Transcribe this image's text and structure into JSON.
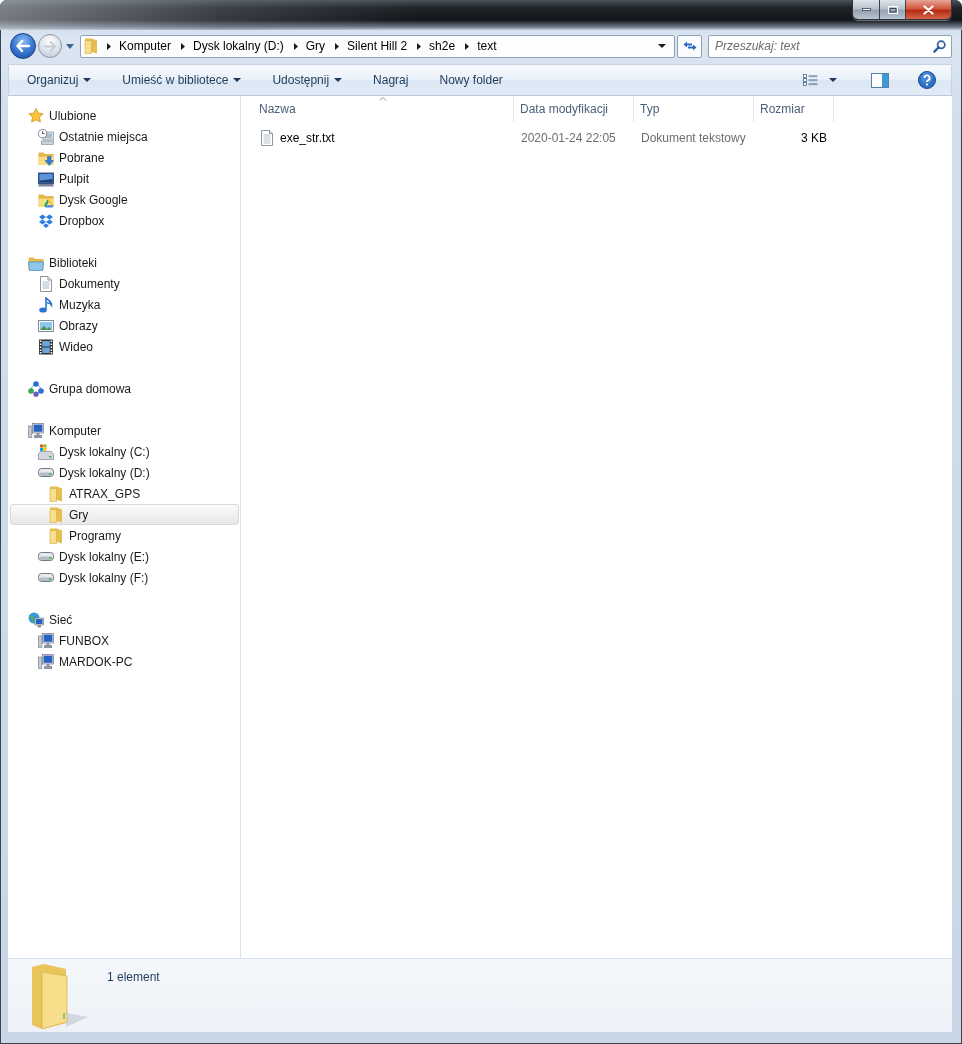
{
  "address_bar": {
    "crumbs": [
      "Komputer",
      "Dysk lokalny (D:)",
      "Gry",
      "Silent Hill 2",
      "sh2e",
      "text"
    ]
  },
  "search": {
    "placeholder": "Przeszukaj: text"
  },
  "toolbar": {
    "items": [
      {
        "label": "Organizuj",
        "has_menu": true
      },
      {
        "label": "Umieść w bibliotece",
        "has_menu": true
      },
      {
        "label": "Udostępnij",
        "has_menu": true
      },
      {
        "label": "Nagraj",
        "has_menu": false
      },
      {
        "label": "Nowy folder",
        "has_menu": false
      }
    ]
  },
  "sidebar": {
    "groups": [
      {
        "label": "Ulubione",
        "kind": "favorites",
        "selected": false,
        "children": [
          {
            "label": "Ostatnie miejsca",
            "kind": "recent",
            "selected": false
          },
          {
            "label": "Pobrane",
            "kind": "downloads",
            "selected": false
          },
          {
            "label": "Pulpit",
            "kind": "desktop",
            "selected": false
          },
          {
            "label": "Dysk Google",
            "kind": "gdrive",
            "selected": false
          },
          {
            "label": "Dropbox",
            "kind": "dropbox",
            "selected": false
          }
        ]
      },
      {
        "label": "Biblioteki",
        "kind": "libraries",
        "selected": false,
        "children": [
          {
            "label": "Dokumenty",
            "kind": "documents",
            "selected": false
          },
          {
            "label": "Muzyka",
            "kind": "music",
            "selected": false
          },
          {
            "label": "Obrazy",
            "kind": "pictures",
            "selected": false
          },
          {
            "label": "Wideo",
            "kind": "videos",
            "selected": false
          }
        ]
      },
      {
        "label": "Grupa domowa",
        "kind": "homegroup",
        "selected": false
      },
      {
        "label": "Komputer",
        "kind": "computer",
        "selected": false,
        "children": [
          {
            "label": "Dysk lokalny (C:)",
            "kind": "system-drive",
            "selected": false
          },
          {
            "label": "Dysk lokalny (D:)",
            "kind": "drive",
            "selected": false,
            "children": [
              {
                "label": "ATRAX_GPS",
                "kind": "folder",
                "selected": false
              },
              {
                "label": "Gry",
                "kind": "folder",
                "selected": true
              },
              {
                "label": "Programy",
                "kind": "folder",
                "selected": false
              }
            ]
          },
          {
            "label": "Dysk lokalny (E:)",
            "kind": "drive",
            "selected": false
          },
          {
            "label": "Dysk lokalny (F:)",
            "kind": "drive",
            "selected": false
          }
        ]
      },
      {
        "label": "Sieć",
        "kind": "network",
        "selected": false,
        "children": [
          {
            "label": "FUNBOX",
            "kind": "pc",
            "selected": false
          },
          {
            "label": "MARDOK-PC",
            "kind": "pc",
            "selected": false
          }
        ]
      }
    ]
  },
  "table": {
    "columns": [
      {
        "label": "Nazwa",
        "sorted": true
      },
      {
        "label": "Data modyfikacji",
        "sorted": false
      },
      {
        "label": "Typ",
        "sorted": false
      },
      {
        "label": "Rozmiar",
        "sorted": false
      }
    ],
    "rows": [
      {
        "kind": "text-file",
        "selected": false,
        "cells": [
          "exe_str.txt",
          "2020-01-24 22:05",
          "Dokument tekstowy",
          "3 KB"
        ]
      }
    ]
  },
  "status_bar": {
    "text": "1 element"
  }
}
